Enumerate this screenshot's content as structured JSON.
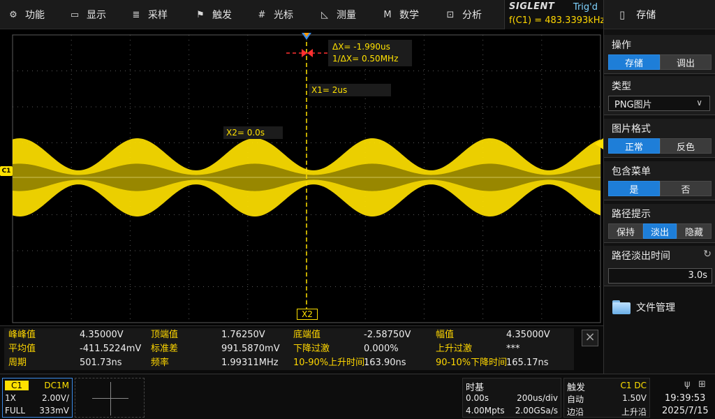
{
  "menu": {
    "items": [
      {
        "label": "功能",
        "icon": "gear-icon",
        "glyph": "⚙"
      },
      {
        "label": "显示",
        "icon": "display-icon",
        "glyph": "▭"
      },
      {
        "label": "采样",
        "icon": "sampling-icon",
        "glyph": "≣"
      },
      {
        "label": "触发",
        "icon": "flag-icon",
        "glyph": "⚑"
      },
      {
        "label": "光标",
        "icon": "cursor-icon",
        "glyph": "#"
      },
      {
        "label": "测量",
        "icon": "measure-icon",
        "glyph": "◺"
      },
      {
        "label": "数学",
        "icon": "math-icon",
        "glyph": "M"
      },
      {
        "label": "分析",
        "icon": "analysis-icon",
        "glyph": "⊡"
      }
    ]
  },
  "brand": {
    "name": "SIGLENT",
    "trigger_status": "Trig'd",
    "frequency_readout": "f(C1) = 483.3393kHz"
  },
  "side_panel": {
    "title": "存储",
    "title_icon": "save-icon",
    "operation": {
      "title": "操作",
      "options": [
        "存储",
        "调出"
      ],
      "selected": 0
    },
    "type": {
      "title": "类型",
      "value": "PNG图片"
    },
    "image_format": {
      "title": "图片格式",
      "options": [
        "正常",
        "反色"
      ],
      "selected": 0
    },
    "include_menu": {
      "title": "包含菜单",
      "options": [
        "是",
        "否"
      ],
      "selected": 0
    },
    "path_hint": {
      "title": "路径提示",
      "options": [
        "保持",
        "淡出",
        "隐藏"
      ],
      "selected": 1
    },
    "fade_time": {
      "title": "路径淡出时间",
      "value": "3.0s"
    },
    "file_manager": "文件管理"
  },
  "waveform": {
    "channel_label": "C1",
    "color": "#ffe100",
    "carrier_cycles": 5,
    "high": 1.7625,
    "low": -2.5875,
    "unit": "V"
  },
  "cursors": {
    "delta_x": "ΔX= -1.990us",
    "inv_delta_x": "1/ΔX= 0.50MHz",
    "x1": "X1= 2us",
    "x2": "X2= 0.0s",
    "x2_flag": "X2"
  },
  "measurements": [
    [
      {
        "label": "峰峰值",
        "value": "4.35000V"
      },
      {
        "label": "顶端值",
        "value": "1.76250V"
      },
      {
        "label": "底端值",
        "value": "-2.58750V"
      },
      {
        "label": "幅值",
        "value": "4.35000V"
      }
    ],
    [
      {
        "label": "平均值",
        "value": "-411.5224mV"
      },
      {
        "label": "标准差",
        "value": "991.5870mV"
      },
      {
        "label": "下降过激",
        "value": "0.000%"
      },
      {
        "label": "上升过激",
        "value": "***"
      }
    ],
    [
      {
        "label": "周期",
        "value": "501.73ns"
      },
      {
        "label": "频率",
        "value": "1.99311MHz"
      },
      {
        "label": "10-90%上升时间",
        "value": "163.90ns"
      },
      {
        "label": "90-10%下降时间",
        "value": "165.17ns"
      }
    ]
  ],
  "channel_box": {
    "name": "C1",
    "coupling": "DC1M",
    "probe": "1X",
    "scale": "2.00V/",
    "bandwidth": "FULL",
    "offset": "333mV"
  },
  "timebase": {
    "title": "时基",
    "delay": "0.00s",
    "scale": "200us/div",
    "memory": "4.00Mpts",
    "sample_rate": "2.00GSa/s"
  },
  "trigger": {
    "title": "触发",
    "source": "C1 DC",
    "mode": "自动",
    "level": "1.50V",
    "type": "边沿",
    "slope": "上升沿"
  },
  "clock": {
    "time": "19:39:53",
    "date": "2025/7/15"
  }
}
